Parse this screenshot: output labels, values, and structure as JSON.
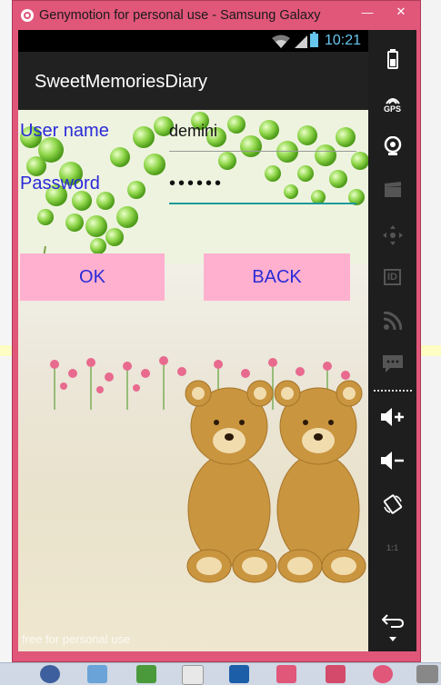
{
  "window": {
    "title": "Genymotion for personal use - Samsung Galaxy",
    "minimize_glyph": "—",
    "close_glyph": "✕"
  },
  "status_bar": {
    "time": "10:21"
  },
  "action_bar": {
    "title": "SweetMemoriesDiary"
  },
  "login": {
    "username_label": "User name",
    "username_value": "demini",
    "password_label": "Password",
    "password_value": "••••••",
    "ok_label": "OK",
    "back_label": "BACK"
  },
  "watermark": "free for personal use",
  "toolbar": {
    "items": [
      "battery-icon",
      "gps-icon",
      "camera-icon",
      "video-icon",
      "dpad-icon",
      "id-icon",
      "rss-icon",
      "sms-icon",
      "volume-up-icon",
      "volume-down-icon",
      "rotate-icon",
      "scale-icon",
      "back-icon"
    ],
    "gps_label": "GPS",
    "id_label": "ID",
    "scale_label": "1:1"
  },
  "colors": {
    "window_frame": "#e0577a",
    "label_blue": "#2a2ad8",
    "button_pink": "#ffb0cf",
    "status_blue": "#66c6ee"
  }
}
